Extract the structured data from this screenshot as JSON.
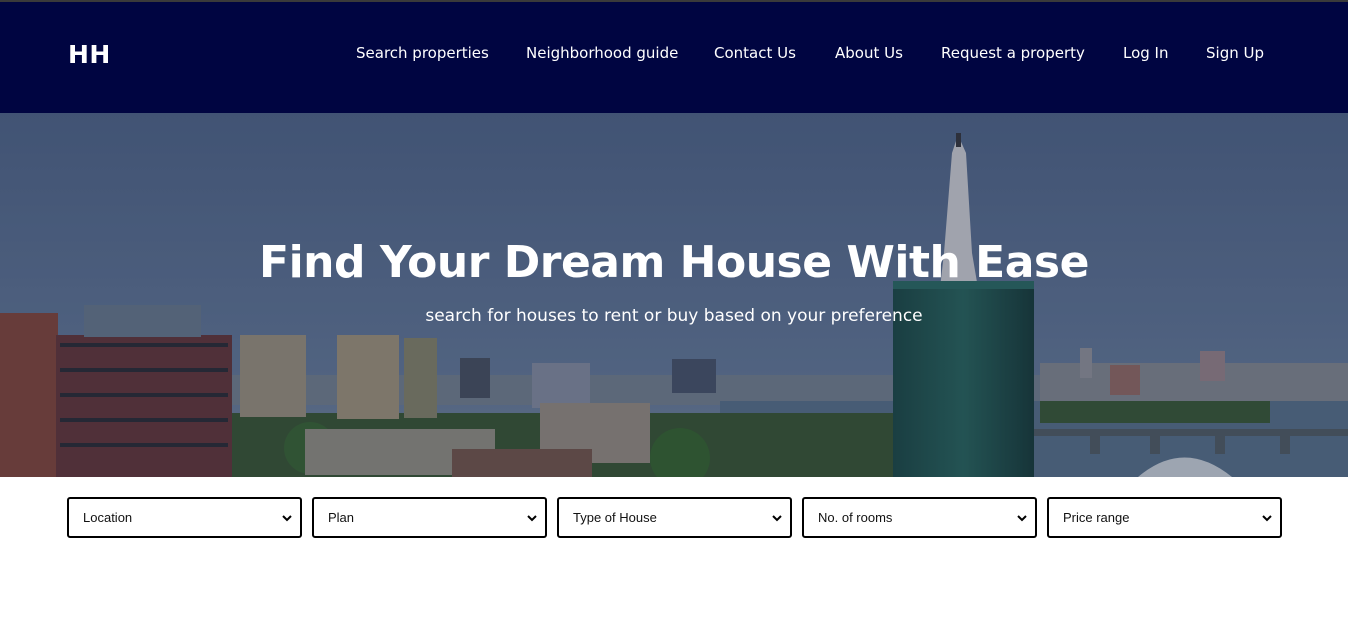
{
  "header": {
    "logo": "HH",
    "nav": [
      {
        "label": "Search properties"
      },
      {
        "label": "Neighborhood guide"
      },
      {
        "label": "Contact Us"
      },
      {
        "label": "About Us"
      },
      {
        "label": "Request a property"
      },
      {
        "label": "Log In"
      },
      {
        "label": "Sign Up"
      }
    ]
  },
  "hero": {
    "title": "Find Your Dream House With Ease",
    "subtitle": "search for houses to rent or buy based on your preference"
  },
  "filters": [
    {
      "selected": "Location"
    },
    {
      "selected": "Plan"
    },
    {
      "selected": "Type of House"
    },
    {
      "selected": "No. of rooms"
    },
    {
      "selected": "Price range"
    }
  ],
  "colors": {
    "header_bg": "#000541",
    "hero_sky": "#5b6f94",
    "text_on_dark": "#ffffff"
  },
  "icons": [
    "chevron-down-icon"
  ]
}
